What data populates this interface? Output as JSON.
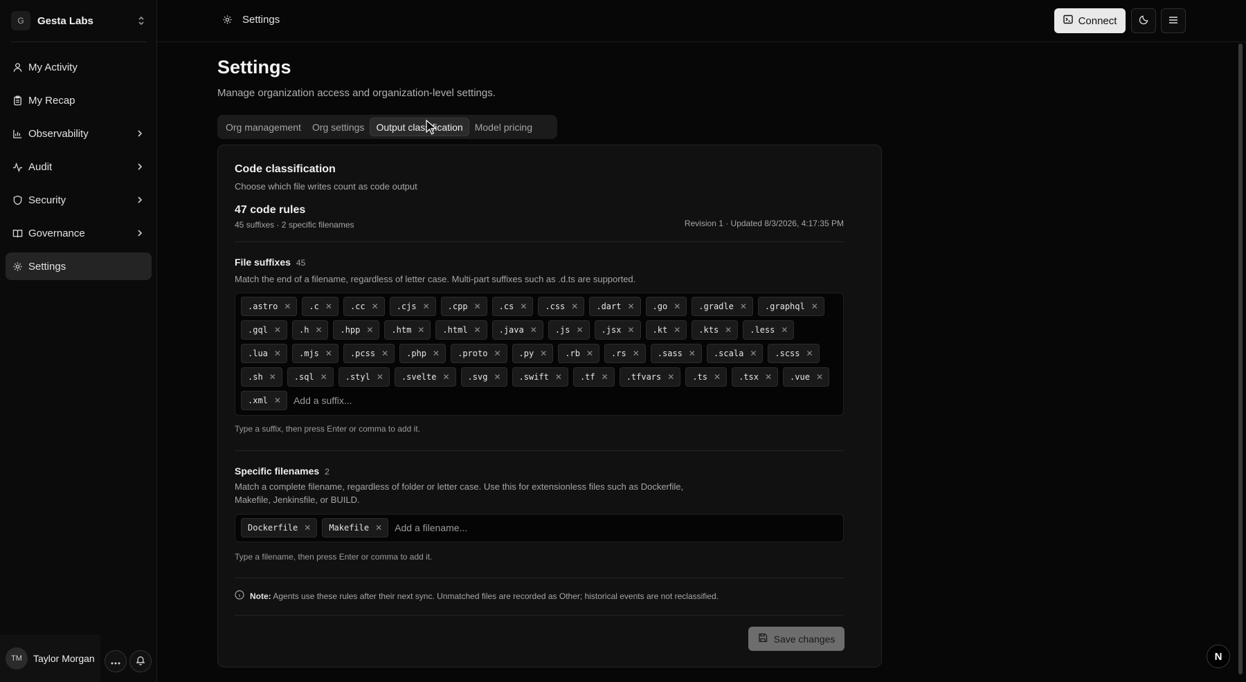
{
  "org": {
    "initial": "G",
    "name": "Gesta Labs"
  },
  "nav": [
    {
      "label": "My Activity",
      "icon": "user-icon",
      "chevron": false,
      "active": false
    },
    {
      "label": "My Recap",
      "icon": "clipboard-icon",
      "chevron": false,
      "active": false
    },
    {
      "label": "Observability",
      "icon": "bar-chart-icon",
      "chevron": true,
      "active": false
    },
    {
      "label": "Audit",
      "icon": "activity-icon",
      "chevron": true,
      "active": false
    },
    {
      "label": "Security",
      "icon": "shield-icon",
      "chevron": true,
      "active": false
    },
    {
      "label": "Governance",
      "icon": "book-icon",
      "chevron": true,
      "active": false
    },
    {
      "label": "Settings",
      "icon": "gear-icon",
      "chevron": false,
      "active": true
    }
  ],
  "user": {
    "initials": "TM",
    "name": "Taylor Morgan"
  },
  "topbar": {
    "breadcrumb": "Settings",
    "connect_label": "Connect"
  },
  "page": {
    "title": "Settings",
    "subtitle": "Manage organization access and organization-level settings."
  },
  "tabs": [
    {
      "label": "Org management",
      "active": false
    },
    {
      "label": "Org settings",
      "active": false
    },
    {
      "label": "Output classification",
      "active": true
    },
    {
      "label": "Model pricing",
      "active": false
    }
  ],
  "card": {
    "title": "Code classification",
    "subtitle": "Choose which file writes count as code output",
    "rules_title": "47 code rules",
    "rules_sub": "45 suffixes · 2 specific filenames",
    "revision": "Revision 1 · Updated 8/3/2026, 4:17:35 PM"
  },
  "suffixes": {
    "title": "File suffixes",
    "count": "45",
    "description": "Match the end of a filename, regardless of letter case. Multi-part suffixes such as .d.ts are supported.",
    "items": [
      ".astro",
      ".c",
      ".cc",
      ".cjs",
      ".cpp",
      ".cs",
      ".css",
      ".dart",
      ".go",
      ".gradle",
      ".graphql",
      ".gql",
      ".h",
      ".hpp",
      ".htm",
      ".html",
      ".java",
      ".js",
      ".jsx",
      ".kt",
      ".kts",
      ".less",
      ".lua",
      ".mjs",
      ".pcss",
      ".php",
      ".proto",
      ".py",
      ".rb",
      ".rs",
      ".sass",
      ".scala",
      ".scss",
      ".sh",
      ".sql",
      ".styl",
      ".svelte",
      ".svg",
      ".swift",
      ".tf",
      ".tfvars",
      ".ts",
      ".tsx",
      ".vue",
      ".xml"
    ],
    "placeholder": "Add a suffix...",
    "hint": "Type a suffix, then press Enter or comma to add it."
  },
  "filenames": {
    "title": "Specific filenames",
    "count": "2",
    "description_line1": "Match a complete filename, regardless of folder or letter case. Use this for extensionless files such as Dockerfile,",
    "description_line2": "Makefile, Jenkinsfile, or BUILD.",
    "items": [
      "Dockerfile",
      "Makefile"
    ],
    "placeholder": "Add a filename...",
    "hint": "Type a filename, then press Enter or comma to add it."
  },
  "note": {
    "label": "Note:",
    "text": "Agents use these rules after their next sync. Unmatched files are recorded as Other; historical events are not reclassified."
  },
  "save_label": "Save changes",
  "corner_badge": "N"
}
